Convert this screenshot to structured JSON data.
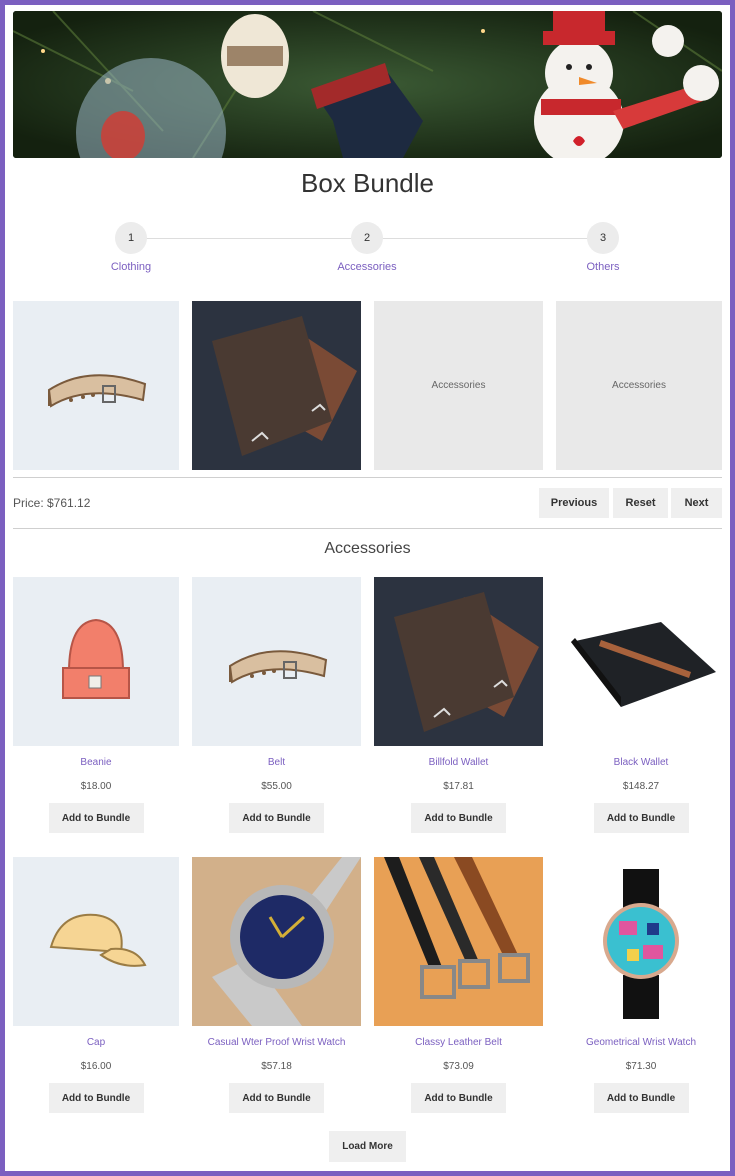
{
  "page": {
    "title": "Box Bundle",
    "section_title": "Accessories",
    "price_text": "Price: $761.12",
    "accent_color": "#7b5fc0"
  },
  "steps": [
    {
      "number": "1",
      "label": "Clothing"
    },
    {
      "number": "2",
      "label": "Accessories"
    },
    {
      "number": "3",
      "label": "Others"
    }
  ],
  "bundle_slots": [
    {
      "type": "image",
      "image": "belt"
    },
    {
      "type": "image",
      "image": "billfold-wallet"
    },
    {
      "type": "placeholder",
      "text": "Accessories"
    },
    {
      "type": "placeholder",
      "text": "Accessories"
    }
  ],
  "nav": {
    "previous": "Previous",
    "reset": "Reset",
    "next": "Next"
  },
  "products": [
    {
      "name": "Beanie",
      "price": "$18.00",
      "image": "beanie"
    },
    {
      "name": "Belt",
      "price": "$55.00",
      "image": "belt"
    },
    {
      "name": "Billfold Wallet",
      "price": "$17.81",
      "image": "billfold-wallet"
    },
    {
      "name": "Black Wallet",
      "price": "$148.27",
      "image": "black-wallet"
    },
    {
      "name": "Cap",
      "price": "$16.00",
      "image": "cap"
    },
    {
      "name": "Casual Wter Proof Wrist Watch",
      "price": "$57.18",
      "image": "wrist-watch"
    },
    {
      "name": "Classy Leather Belt",
      "price": "$73.09",
      "image": "leather-belts"
    },
    {
      "name": "Geometrical Wrist Watch",
      "price": "$71.30",
      "image": "geometrical-watch"
    }
  ],
  "add_to_bundle_label": "Add to Bundle",
  "load_more_label": "Load More"
}
